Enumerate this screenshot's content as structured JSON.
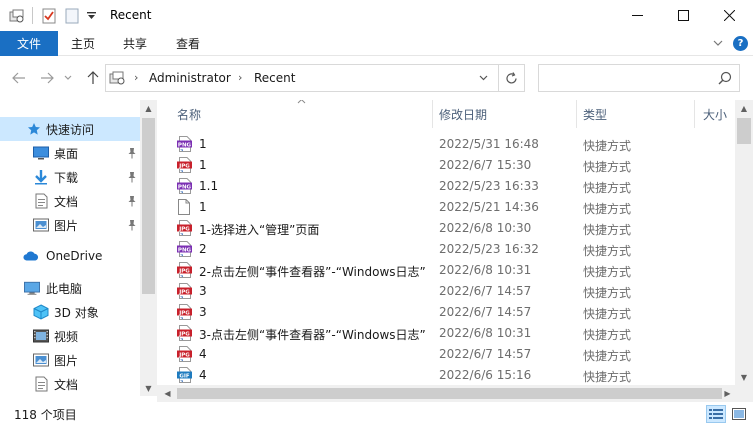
{
  "window": {
    "title": "Recent",
    "minimize": "—",
    "maximize": "☐",
    "close": "✕"
  },
  "ribbon": {
    "tabs": [
      {
        "label": "文件"
      },
      {
        "label": "主页"
      },
      {
        "label": "共享"
      },
      {
        "label": "查看"
      }
    ],
    "help": "?"
  },
  "address": {
    "crumbs": [
      "Administrator",
      "Recent"
    ],
    "search_placeholder": ""
  },
  "nav": {
    "items": [
      {
        "label": "快速访问",
        "icon": "star-icon",
        "selected": true
      },
      {
        "label": "桌面",
        "icon": "desktop-icon",
        "pinned": true
      },
      {
        "label": "下载",
        "icon": "download-icon",
        "pinned": true
      },
      {
        "label": "文档",
        "icon": "document-icon",
        "pinned": true
      },
      {
        "label": "图片",
        "icon": "picture-icon",
        "pinned": true
      },
      {
        "label": "OneDrive",
        "icon": "cloud-icon"
      },
      {
        "label": "此电脑",
        "icon": "computer-icon"
      },
      {
        "label": "3D 对象",
        "icon": "cube-icon"
      },
      {
        "label": "视频",
        "icon": "video-icon"
      },
      {
        "label": "图片",
        "icon": "picture-icon"
      },
      {
        "label": "文档",
        "icon": "document-icon"
      }
    ]
  },
  "columns": {
    "name": "名称",
    "date": "修改日期",
    "type": "类型",
    "size": "大小"
  },
  "files": [
    {
      "name": "1",
      "date": "2022/5/31 16:48",
      "type": "快捷方式",
      "icon": "png"
    },
    {
      "name": "1",
      "date": "2022/6/7 15:30",
      "type": "快捷方式",
      "icon": "jpg"
    },
    {
      "name": "1.1",
      "date": "2022/5/23 16:33",
      "type": "快捷方式",
      "icon": "png"
    },
    {
      "name": "1",
      "date": "2022/5/21 14:36",
      "type": "快捷方式",
      "icon": "blank"
    },
    {
      "name": "1-选择进入“管理”页面",
      "date": "2022/6/8 10:30",
      "type": "快捷方式",
      "icon": "jpg"
    },
    {
      "name": "2",
      "date": "2022/5/23 16:32",
      "type": "快捷方式",
      "icon": "png"
    },
    {
      "name": "2-点击左侧“事件查看器”-“Windows日志”",
      "date": "2022/6/8 10:31",
      "type": "快捷方式",
      "icon": "jpg"
    },
    {
      "name": "3",
      "date": "2022/6/7 14:57",
      "type": "快捷方式",
      "icon": "jpg"
    },
    {
      "name": "3",
      "date": "2022/6/7 14:57",
      "type": "快捷方式",
      "icon": "jpg"
    },
    {
      "name": "3-点击左侧“事件查看器”-“Windows日志”",
      "date": "2022/6/8 10:31",
      "type": "快捷方式",
      "icon": "jpg"
    },
    {
      "name": "4",
      "date": "2022/6/7 14:57",
      "type": "快捷方式",
      "icon": "jpg"
    },
    {
      "name": "4",
      "date": "2022/6/6 15:16",
      "type": "快捷方式",
      "icon": "gif"
    }
  ],
  "status": {
    "count": "118 个项目"
  },
  "icon_colors": {
    "png": "#7b2fb3",
    "jpg": "#c8202b",
    "gif": "#1e7bbf",
    "accent": "#1a6fc3"
  }
}
